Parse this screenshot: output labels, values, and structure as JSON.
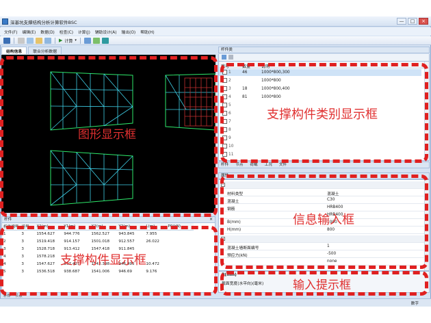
{
  "window": {
    "title": "深基坑支撑结构分析计算软件BSC",
    "min": "—",
    "max": "□",
    "close": "×"
  },
  "menu": [
    "文件(F)",
    "编辑(E)",
    "数据(D)",
    "检查(C)",
    "计算(J)",
    "辅助设计(A)",
    "输出(O)",
    "帮助(H)"
  ],
  "toolbar": {
    "calc_label": "计算"
  },
  "tabs": [
    "结构信息",
    "联合分析数据"
  ],
  "right_panel": {
    "title": "杆件类"
  },
  "types_table": {
    "headers": [
      "序号",
      "数量",
      "说明"
    ],
    "rows": [
      {
        "no": "1",
        "qty": "46",
        "desc": "1000*800,300"
      },
      {
        "no": "2",
        "qty": "",
        "desc": "1000*800"
      },
      {
        "no": "3",
        "qty": "18",
        "desc": "1000*800,400"
      },
      {
        "no": "4",
        "qty": "81",
        "desc": "1000*800"
      },
      {
        "no": "5",
        "qty": "",
        "desc": ""
      },
      {
        "no": "6",
        "qty": "",
        "desc": ""
      },
      {
        "no": "7",
        "qty": "",
        "desc": ""
      },
      {
        "no": "8",
        "qty": "",
        "desc": ""
      },
      {
        "no": "9",
        "qty": "",
        "desc": ""
      },
      {
        "no": "10",
        "qty": "",
        "desc": ""
      },
      {
        "no": "11",
        "qty": "",
        "desc": ""
      }
    ]
  },
  "mid_tabs": [
    "杆件",
    "节点",
    "荷载",
    "工况",
    "文件"
  ],
  "properties": {
    "title": "属性",
    "rows": [
      {
        "group": true,
        "k": "",
        "v": ""
      },
      {
        "k": "材料类型",
        "v": "混凝土"
      },
      {
        "k": "混凝土",
        "v": "C30"
      },
      {
        "k": "钢筋",
        "v": "HRB400"
      },
      {
        "k": "",
        "v": "HRB400"
      },
      {
        "k": "B(mm)",
        "v": "1000"
      },
      {
        "k": "H(mm)",
        "v": "800"
      },
      {
        "group": true,
        "k": "",
        "v": ""
      },
      {
        "k": "混凝土墙断面编号",
        "v": "1"
      },
      {
        "k": "预应力(kN)",
        "v": "-500"
      },
      {
        "k": "",
        "v": "none"
      }
    ]
  },
  "hint": {
    "title": "B(mm)",
    "text": "截面宽度(水平向)(毫米)"
  },
  "members_panel": {
    "title": "杆件",
    "headers": [
      "杆件编号",
      "组号",
      "X1(m)",
      "Y1(m)",
      "X2(m)",
      "Y2(m)",
      "L(m)",
      "P0(kN)"
    ],
    "rows": [
      [
        "1",
        "3",
        "1554.627",
        "944.776",
        "1562.527",
        "943.845",
        "7.955",
        ""
      ],
      [
        "2",
        "3",
        "1519.418",
        "914.157",
        "1501.018",
        "912.557",
        "26.022",
        ""
      ],
      [
        "3",
        "3",
        "1528.718",
        "913.412",
        "1547.418",
        "911.845",
        "",
        ""
      ],
      [
        "4",
        "3",
        "1578.218",
        "",
        "",
        "",
        "",
        ""
      ],
      [
        "4",
        "3",
        "1547.627",
        "937.421",
        "1542.398",
        "946.495",
        "10.472",
        ""
      ],
      [
        "5",
        "3",
        "1536.518",
        "938.687",
        "1541.006",
        "946.69",
        "9.176",
        ""
      ]
    ]
  },
  "bottom_tabs": [
    "杆件",
    "节点"
  ],
  "status": {
    "right": "数字"
  },
  "annotations": {
    "graphics": "图形显示框",
    "types": "支撑构件类别显示框",
    "members": "支撑构件显示框",
    "info": "信息输入框",
    "hint": "输入提示框"
  }
}
